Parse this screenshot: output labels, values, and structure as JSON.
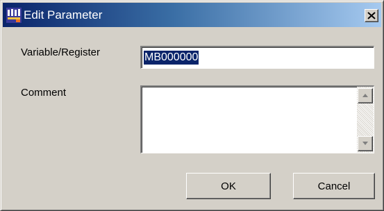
{
  "window": {
    "title": "Edit Parameter",
    "app_icon": "app-icon",
    "close_icon": "close-icon"
  },
  "form": {
    "variable_label": "Variable/Register",
    "variable_value": "MB000000",
    "comment_label": "Comment",
    "comment_value": ""
  },
  "buttons": {
    "ok_label": "OK",
    "cancel_label": "Cancel"
  },
  "colors": {
    "title_gradient_start": "#0a246a",
    "title_gradient_end": "#a6caf0",
    "face": "#d4d0c8",
    "selection": "#0a246a"
  }
}
